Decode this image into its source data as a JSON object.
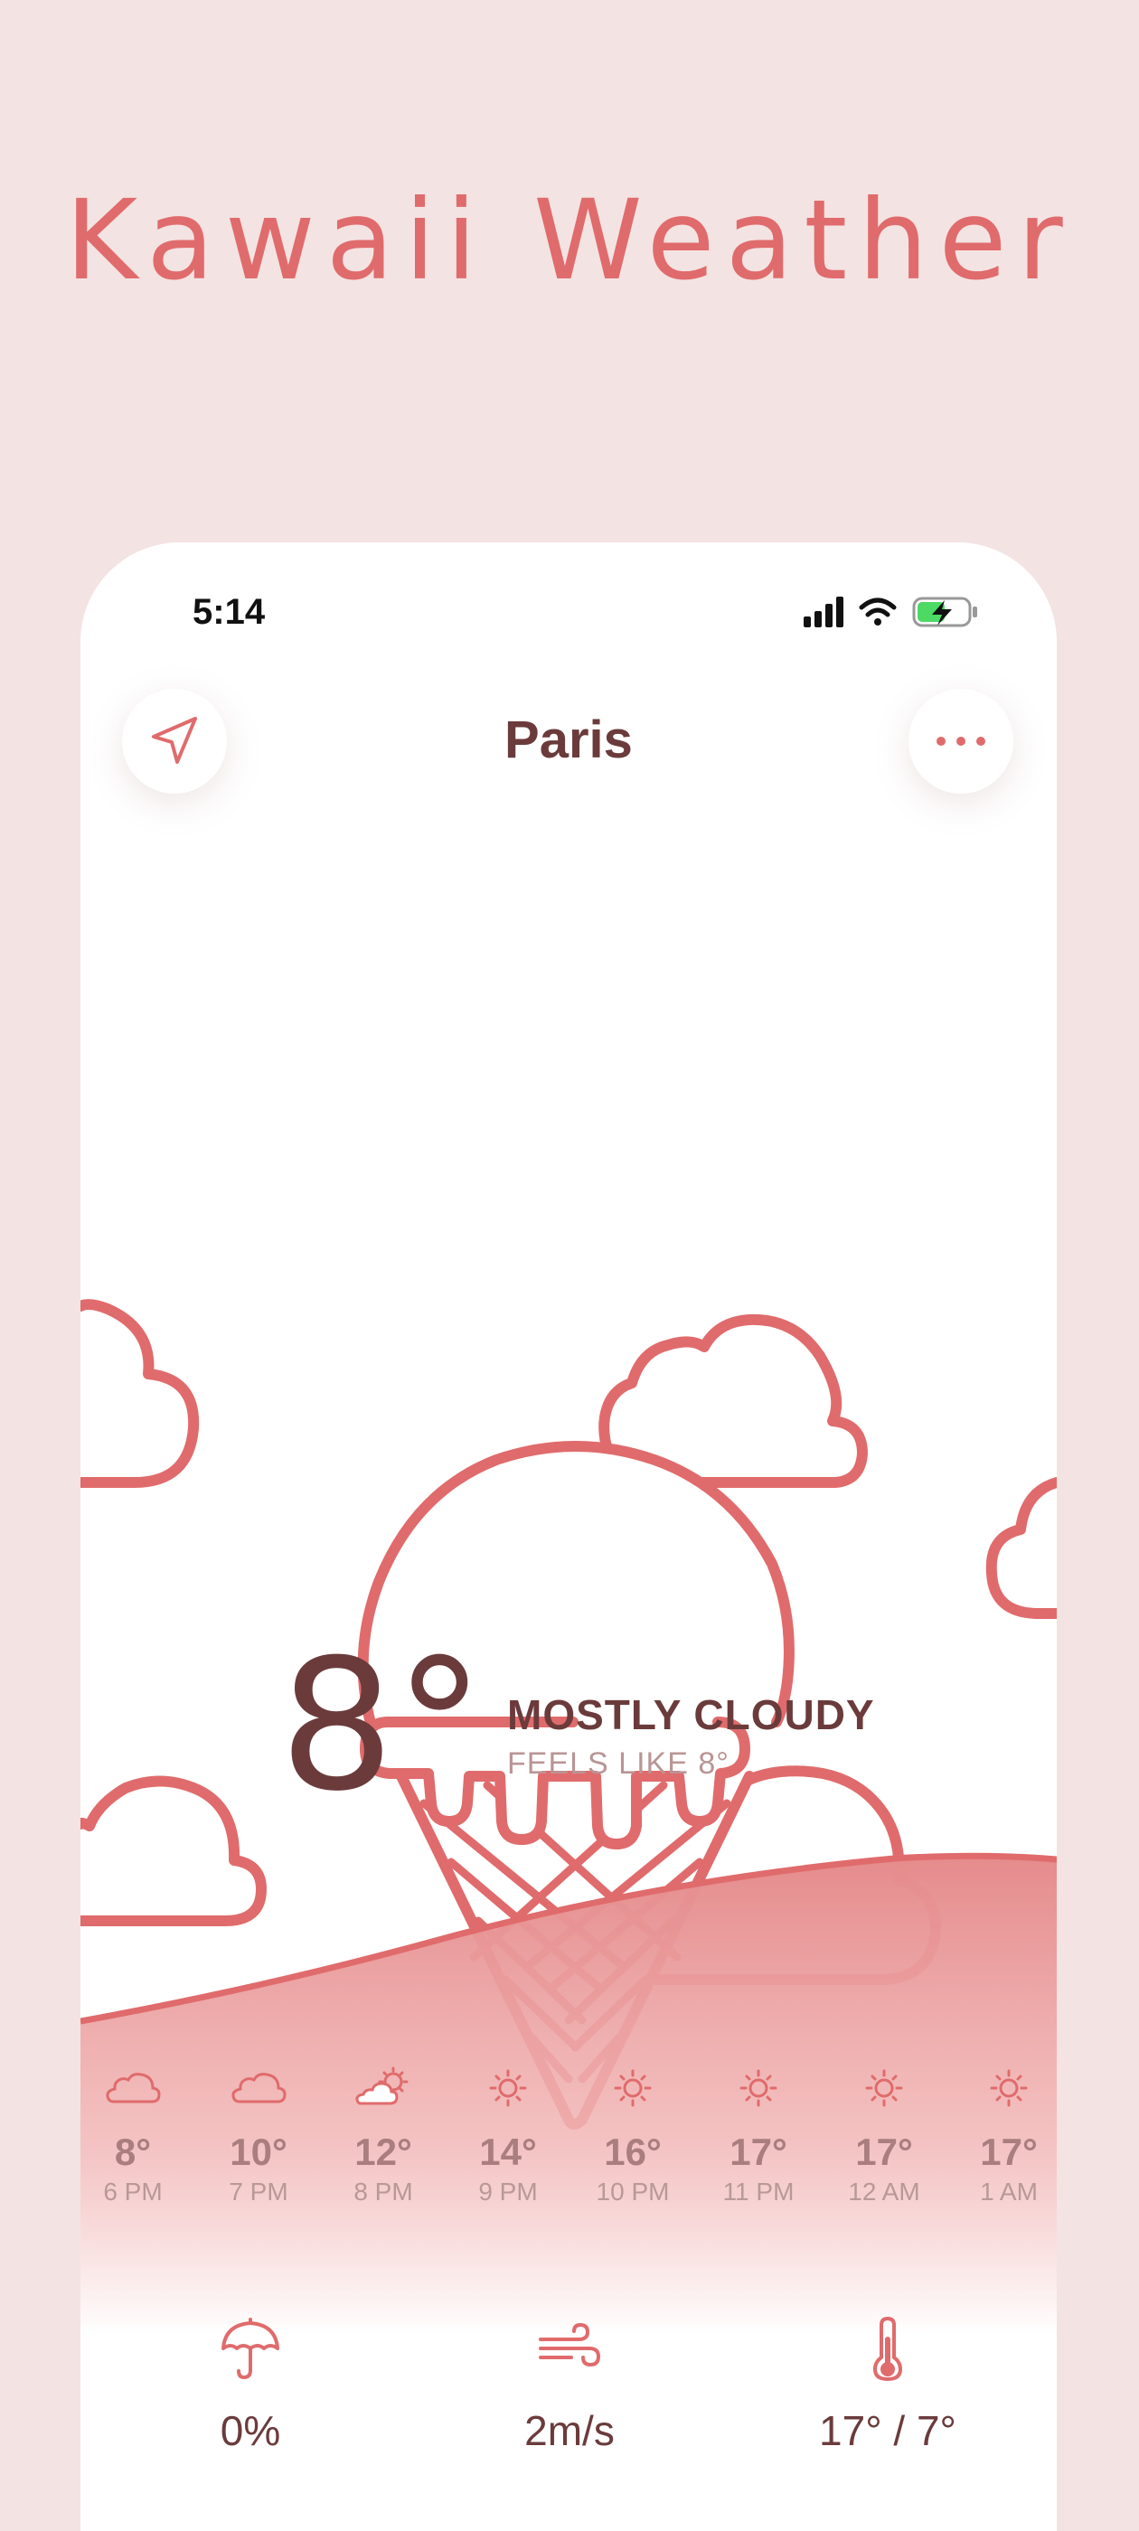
{
  "app_title": "Kawaii Weather",
  "status_bar": {
    "time": "5:14"
  },
  "header": {
    "city": "Paris"
  },
  "current": {
    "temperature": "8°",
    "condition": "MOSTLY CLOUDY",
    "feels_like": "FEELS LIKE 8°"
  },
  "hourly": [
    {
      "icon": "cloud-icon",
      "temp": "8°",
      "time": "6 PM"
    },
    {
      "icon": "cloud-icon",
      "temp": "10°",
      "time": "7 PM"
    },
    {
      "icon": "partly-sunny-icon",
      "temp": "12°",
      "time": "8 PM"
    },
    {
      "icon": "sun-icon",
      "temp": "14°",
      "time": "9 PM"
    },
    {
      "icon": "sun-icon",
      "temp": "16°",
      "time": "10 PM"
    },
    {
      "icon": "sun-icon",
      "temp": "17°",
      "time": "11 PM"
    },
    {
      "icon": "sun-icon",
      "temp": "17°",
      "time": "12 AM"
    },
    {
      "icon": "sun-icon",
      "temp": "17°",
      "time": "1 AM"
    }
  ],
  "stats": {
    "precipitation": {
      "icon": "umbrella-icon",
      "value": "0%"
    },
    "wind": {
      "icon": "wind-icon",
      "value": "2m/s"
    },
    "temp_range": {
      "icon": "thermometer-icon",
      "value": "17° / 7°"
    }
  },
  "colors": {
    "accent": "#e06b6c",
    "text_dark": "#6b3b3c",
    "text_muted": "#b99595",
    "background": "#f4e3e3"
  }
}
